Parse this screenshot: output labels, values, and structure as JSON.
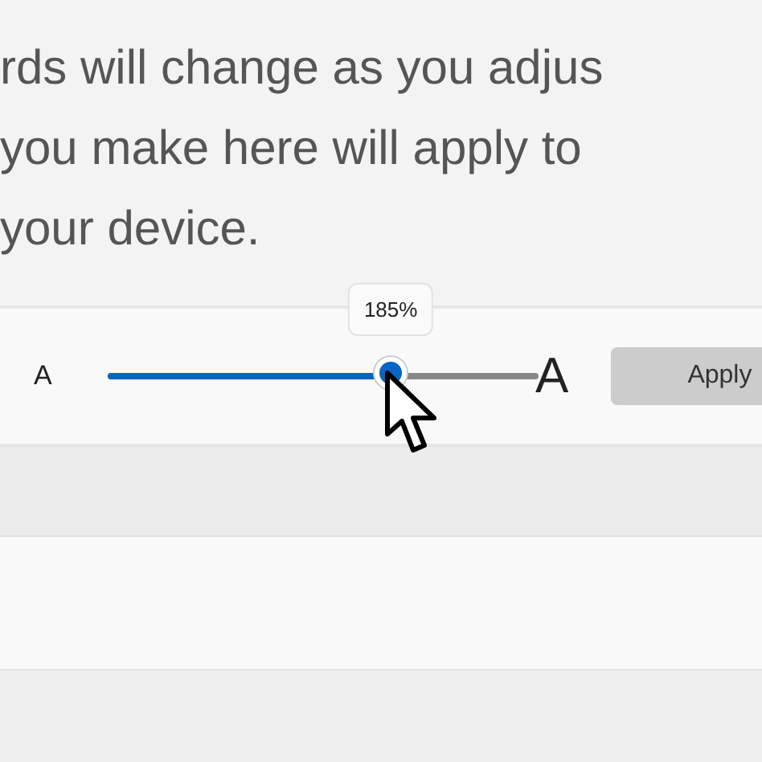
{
  "description_lines": [
    "rds will change as you adjus",
    "you make here will apply to",
    "your device."
  ],
  "text_size": {
    "small_label": "A",
    "large_label": "A",
    "level": 0.657,
    "tooltip": "185%",
    "apply_button": "Apply"
  }
}
